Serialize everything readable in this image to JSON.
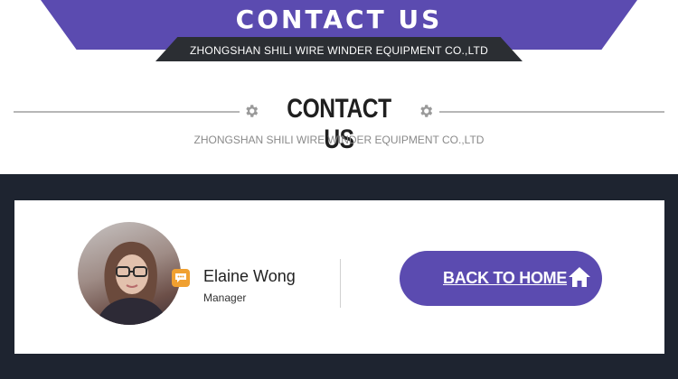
{
  "banner": {
    "title": "CONTACT US",
    "subtitle": "ZHONGSHAN SHILI WIRE WINDER EQUIPMENT CO.,LTD"
  },
  "section": {
    "title": "CONTACT US",
    "subtitle": "ZHONGSHAN SHILI WIRE WINDER EQUIPMENT CO.,LTD"
  },
  "contact": {
    "name": "Elaine Wong",
    "role": "Manager",
    "avatar_icon": "person-photo",
    "chat_icon": "chat-bubble-icon"
  },
  "home_button": {
    "label": "BACK TO HOME",
    "icon": "home-icon"
  },
  "colors": {
    "accent": "#5b4bb0",
    "dark_band": "#1e2430",
    "banner_sub_bg": "#2b2e33",
    "chat_badge": "#f0a030"
  }
}
